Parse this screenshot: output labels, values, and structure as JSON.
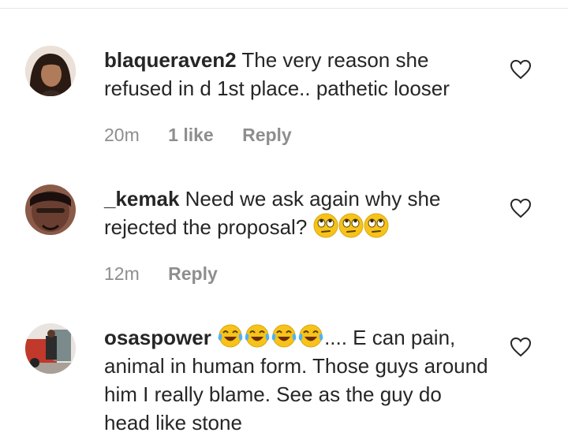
{
  "comments": [
    {
      "username": "blaqueraven2",
      "text": "The very reason she refused in d 1st place.. pathetic looser",
      "time": "20m",
      "likes": "1 like",
      "reply": "Reply"
    },
    {
      "username": "_kemak",
      "text": "Need we ask again why she rejected the proposal?",
      "emoji_name": "face-with-rolling-eyes",
      "emoji_count": 3,
      "time": "12m",
      "reply": "Reply"
    },
    {
      "username": "osaspower",
      "emoji_name": "face-with-tears-of-joy",
      "emoji_count": 4,
      "text": ".... E can pain, animal in human form. Those guys around him I really blame. See as the guy do head like stone"
    }
  ],
  "colors": {
    "text": "#262626",
    "meta": "#8e8e8e",
    "emoji_yellow": "#f7c31b"
  },
  "icons": {
    "like": "heart-outline-icon"
  }
}
